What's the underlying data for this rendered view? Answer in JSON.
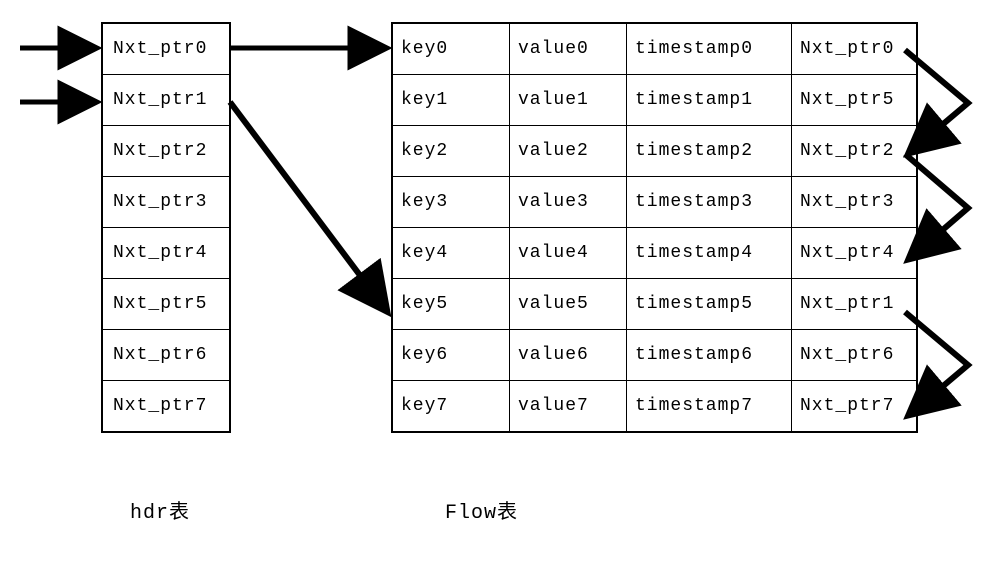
{
  "hdr": {
    "label": "hdr表",
    "rows": [
      "Nxt_ptr0",
      "Nxt_ptr1",
      "Nxt_ptr2",
      "Nxt_ptr3",
      "Nxt_ptr4",
      "Nxt_ptr5",
      "Nxt_ptr6",
      "Nxt_ptr7"
    ]
  },
  "flow": {
    "label": "Flow表",
    "rows": [
      {
        "key": "key0",
        "value": "value0",
        "ts": "timestamp0",
        "ptr": "Nxt_ptr0"
      },
      {
        "key": "key1",
        "value": "value1",
        "ts": "timestamp1",
        "ptr": "Nxt_ptr5"
      },
      {
        "key": "key2",
        "value": "value2",
        "ts": "timestamp2",
        "ptr": "Nxt_ptr2"
      },
      {
        "key": "key3",
        "value": "value3",
        "ts": "timestamp3",
        "ptr": "Nxt_ptr3"
      },
      {
        "key": "key4",
        "value": "value4",
        "ts": "timestamp4",
        "ptr": "Nxt_ptr4"
      },
      {
        "key": "key5",
        "value": "value5",
        "ts": "timestamp5",
        "ptr": "Nxt_ptr1"
      },
      {
        "key": "key6",
        "value": "value6",
        "ts": "timestamp6",
        "ptr": "Nxt_ptr6"
      },
      {
        "key": "key7",
        "value": "value7",
        "ts": "timestamp7",
        "ptr": "Nxt_ptr7"
      }
    ]
  }
}
